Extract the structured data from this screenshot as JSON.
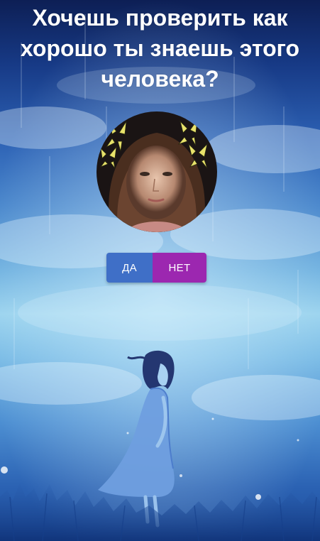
{
  "header": {
    "title": "Хочешь проверить как хорошо ты знаешь этого человека?"
  },
  "avatar": {
    "alt": "profile photo with butterflies"
  },
  "buttons": {
    "yes_label": "ДА",
    "no_label": "НЕТ"
  },
  "colors": {
    "yes_button": "#3f6fc7",
    "no_button": "#9c27b0",
    "title_text": "#ffffff"
  }
}
